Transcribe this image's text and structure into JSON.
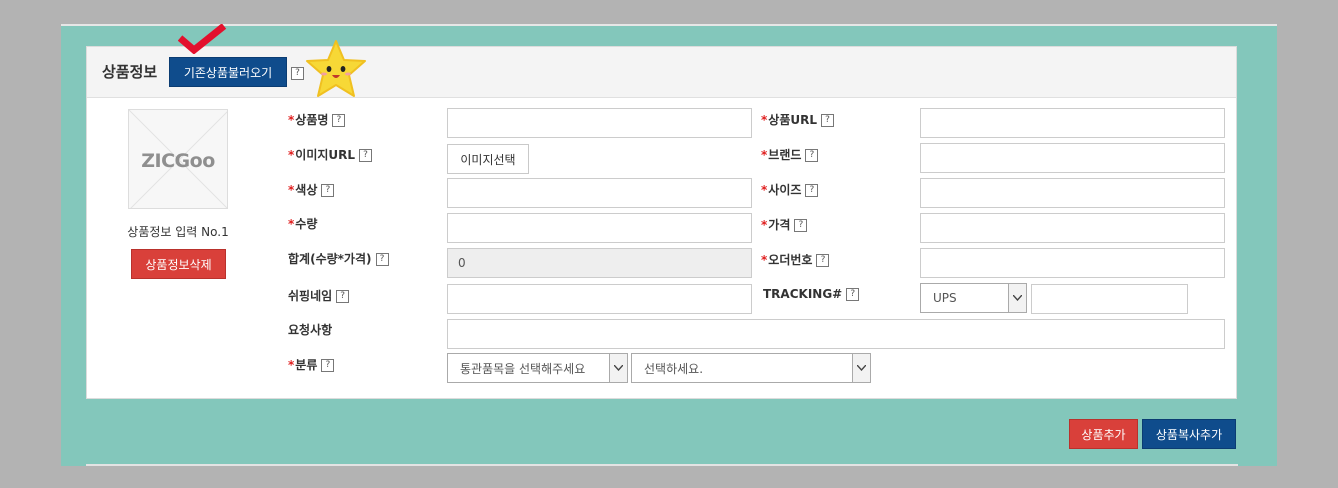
{
  "panel": {
    "title": "상품정보",
    "load_button": "기존상품불러오기",
    "help": "?"
  },
  "left": {
    "logo": "ZICGoo",
    "entry_no": "상품정보 입력 No.1",
    "delete_button": "상품정보삭제"
  },
  "fields": {
    "product_name": "상품명",
    "product_url": "상품URL",
    "image_url": "이미지URL",
    "image_select": "이미지선택",
    "brand": "브랜드",
    "color": "색상",
    "size": "사이즈",
    "quantity": "수량",
    "price": "가격",
    "total": "합계(수량*가격)",
    "total_value": "0",
    "order_no": "오더번호",
    "shipping_name": "쉬핑네임",
    "tracking": "TRACKING#",
    "tracking_carrier": "UPS",
    "request": "요청사항",
    "category": "분류",
    "category_customs": "통관품목을 선택해주세요",
    "category_select": "선택하세요."
  },
  "actions": {
    "add_product": "상품추가",
    "copy_add_product": "상품복사추가"
  },
  "colors": {
    "background": "#b3b3b3",
    "teal": "#83c7bb",
    "primary_blue": "#0f4c8c",
    "danger_red": "#d9403a",
    "required_star": "#e02020"
  }
}
